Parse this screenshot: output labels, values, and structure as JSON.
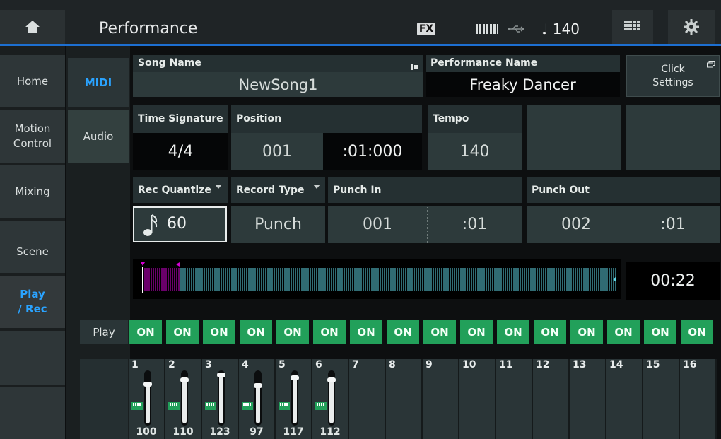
{
  "header": {
    "title": "Performance",
    "fx_label": "FX",
    "tempo": "♩ 140"
  },
  "nav": {
    "items": [
      {
        "label": "Home"
      },
      {
        "label": "Motion\nControl"
      },
      {
        "label": "Mixing"
      },
      {
        "label": "Scene"
      },
      {
        "label": "Play\n/ Rec"
      }
    ]
  },
  "subnav": {
    "items": [
      {
        "label": "MIDI"
      },
      {
        "label": "Audio"
      }
    ]
  },
  "song": {
    "label": "Song Name",
    "value": "NewSong1"
  },
  "performance": {
    "label": "Performance Name",
    "value": "Freaky Dancer"
  },
  "click_settings": {
    "label": "Click\nSettings"
  },
  "time_signature": {
    "label": "Time Signature",
    "value": "4/4"
  },
  "position": {
    "label": "Position",
    "measure": "001",
    "beat_tick": ":01:000"
  },
  "tempo": {
    "label": "Tempo",
    "value": "140"
  },
  "rec_quantize": {
    "label": "Rec Quantize",
    "value": "60"
  },
  "record_type": {
    "label": "Record Type",
    "value": "Punch"
  },
  "punch_in": {
    "label": "Punch In",
    "measure": "001",
    "beat": ":01"
  },
  "punch_out": {
    "label": "Punch Out",
    "measure": "002",
    "beat": ":01"
  },
  "time_display": "00:22",
  "play_row": {
    "label": "Play",
    "buttons": [
      "ON",
      "ON",
      "ON",
      "ON",
      "ON",
      "ON",
      "ON",
      "ON",
      "ON",
      "ON",
      "ON",
      "ON",
      "ON",
      "ON",
      "ON",
      "ON"
    ]
  },
  "tracks": [
    {
      "num": "1",
      "value": "100",
      "level": 0.79,
      "has_fader": true
    },
    {
      "num": "2",
      "value": "110",
      "level": 0.87,
      "has_fader": true
    },
    {
      "num": "3",
      "value": "123",
      "level": 0.97,
      "has_fader": true
    },
    {
      "num": "4",
      "value": "97",
      "level": 0.76,
      "has_fader": true
    },
    {
      "num": "5",
      "value": "117",
      "level": 0.92,
      "has_fader": true
    },
    {
      "num": "6",
      "value": "112",
      "level": 0.88,
      "has_fader": true
    },
    {
      "num": "7",
      "value": "",
      "has_fader": false
    },
    {
      "num": "8",
      "value": "",
      "has_fader": false
    },
    {
      "num": "9",
      "value": "",
      "has_fader": false
    },
    {
      "num": "10",
      "value": "",
      "has_fader": false
    },
    {
      "num": "11",
      "value": "",
      "has_fader": false
    },
    {
      "num": "12",
      "value": "",
      "has_fader": false
    },
    {
      "num": "13",
      "value": "",
      "has_fader": false
    },
    {
      "num": "14",
      "value": "",
      "has_fader": false
    },
    {
      "num": "15",
      "value": "",
      "has_fader": false
    },
    {
      "num": "16",
      "value": "",
      "has_fader": false
    }
  ],
  "colors": {
    "accent": "#1d6fd1",
    "active_text": "#2aa3ff",
    "on_green": "#22a05a",
    "loop_magenta": "#d400d4",
    "wave_cyan": "#5fd6e6"
  }
}
